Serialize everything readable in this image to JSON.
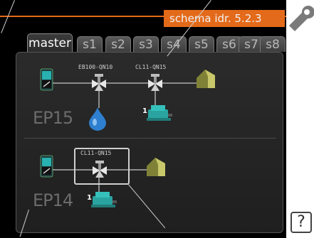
{
  "title": "schema idr.  5.2.3",
  "tabs": [
    {
      "label": "master",
      "active": true
    },
    {
      "label": "s1"
    },
    {
      "label": "s2"
    },
    {
      "label": "s3"
    },
    {
      "label": "s4"
    },
    {
      "label": "s5"
    },
    {
      "label": "s6"
    },
    {
      "label": "s7"
    },
    {
      "label": "s8"
    }
  ],
  "ep15": {
    "name": "EP15",
    "valve1_label": "EB100-QN10",
    "valve2_label": "CL11-QN15",
    "pump_number": "1"
  },
  "ep14": {
    "name": "EP14",
    "valve_label": "CL11-QN15",
    "pump_number": "1"
  },
  "help": "?",
  "colors": {
    "accent": "#e36a1a",
    "panel": "#262626",
    "pipe": "#8c8c8c"
  }
}
